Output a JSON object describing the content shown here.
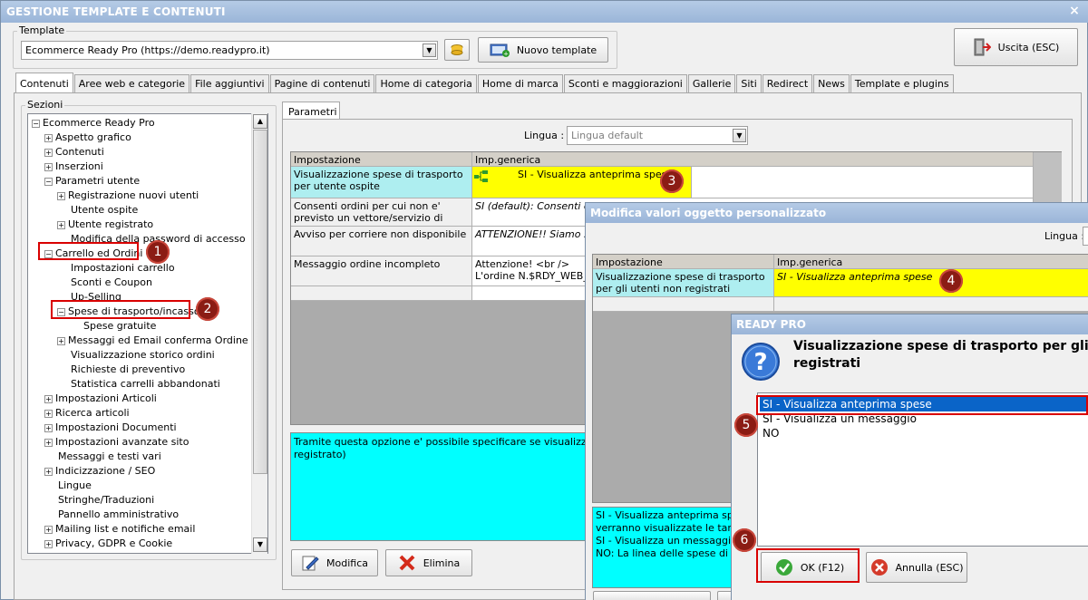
{
  "window": {
    "title": "GESTIONE TEMPLATE E CONTENUTI",
    "close": "×"
  },
  "template_group": {
    "label": "Template",
    "value": "Ecommerce Ready Pro (https://demo.readypro.it)"
  },
  "buttons": {
    "new_template": "Nuovo template",
    "exit": "Uscita (ESC)",
    "modify": "Modifica",
    "delete": "Elimina",
    "ok": "OK (F12)",
    "cancel": "Annulla (ESC)"
  },
  "tabs": [
    "Contenuti",
    "Aree web e categorie",
    "File aggiuntivi",
    "Pagine di contenuti",
    "Home di categoria",
    "Home di marca",
    "Sconti e maggiorazioni",
    "Gallerie",
    "Siti",
    "Redirect",
    "News",
    "Template e plugins"
  ],
  "sections": {
    "label": "Sezioni",
    "items": [
      {
        "text": "Ecommerce Ready Pro",
        "level": 0,
        "exp": "−"
      },
      {
        "text": "Aspetto grafico",
        "level": 1,
        "exp": "+"
      },
      {
        "text": "Contenuti",
        "level": 1,
        "exp": "+"
      },
      {
        "text": "Inserzioni",
        "level": 1,
        "exp": "+"
      },
      {
        "text": "Parametri utente",
        "level": 1,
        "exp": "−"
      },
      {
        "text": "Registrazione nuovi utenti",
        "level": 2,
        "exp": "+"
      },
      {
        "text": "Utente ospite",
        "level": 2,
        "exp": ""
      },
      {
        "text": "Utente registrato",
        "level": 2,
        "exp": "+"
      },
      {
        "text": "Modifica della password di accesso",
        "level": 2,
        "exp": ""
      },
      {
        "text": "Carrello ed Ordini",
        "level": 1,
        "exp": "−"
      },
      {
        "text": "Impostazioni carrello",
        "level": 2,
        "exp": ""
      },
      {
        "text": "Sconti e Coupon",
        "level": 2,
        "exp": ""
      },
      {
        "text": "Up-Selling",
        "level": 2,
        "exp": ""
      },
      {
        "text": "Spese di trasporto/incasso",
        "level": 2,
        "exp": "−"
      },
      {
        "text": "Spese gratuite",
        "level": 3,
        "exp": ""
      },
      {
        "text": "Messaggi ed Email conferma Ordine",
        "level": 2,
        "exp": "+"
      },
      {
        "text": "Visualizzazione storico ordini",
        "level": 2,
        "exp": ""
      },
      {
        "text": "Richieste di preventivo",
        "level": 2,
        "exp": ""
      },
      {
        "text": "Statistica carrelli abbandonati",
        "level": 2,
        "exp": ""
      },
      {
        "text": "Impostazioni Articoli",
        "level": 1,
        "exp": "+"
      },
      {
        "text": "Ricerca articoli",
        "level": 1,
        "exp": "+"
      },
      {
        "text": "Impostazioni Documenti",
        "level": 1,
        "exp": "+"
      },
      {
        "text": "Impostazioni avanzate sito",
        "level": 1,
        "exp": "+"
      },
      {
        "text": "Messaggi e testi vari",
        "level": 1,
        "exp": ""
      },
      {
        "text": "Indicizzazione / SEO",
        "level": 1,
        "exp": "+"
      },
      {
        "text": "Lingue",
        "level": 1,
        "exp": ""
      },
      {
        "text": "Stringhe/Traduzioni",
        "level": 1,
        "exp": ""
      },
      {
        "text": "Pannello amministrativo",
        "level": 1,
        "exp": ""
      },
      {
        "text": "Mailing list e notifiche email",
        "level": 1,
        "exp": "+"
      },
      {
        "text": "Privacy, GDPR e Cookie",
        "level": 1,
        "exp": "+"
      }
    ]
  },
  "params": {
    "tab": "Parametri",
    "language_label": "Lingua :",
    "language_value": "Lingua default",
    "col_setting": "Impostazione",
    "col_value": "Imp.generica",
    "rows": [
      {
        "setting": "Visualizzazione spese di trasporto per utente ospite",
        "value": "SI - Visualizza anteprima spese"
      },
      {
        "setting": "Consenti ordini per cui non e' previsto un vettore/servizio di consegna",
        "value": "SI (default): Consenti ordi"
      },
      {
        "setting": "Avviso per corriere non disponibile",
        "value": "ATTENZIONE!! Siamo spia"
      },
      {
        "setting": "Messaggio ordine incompleto",
        "value": "Attenzione! <br />",
        "value2": "L'ordine N.$RDY_WEB_OR"
      }
    ],
    "description": "Tramite questa opzione e' possibile specificare se visualizzare o men",
    "description2": "registrato)"
  },
  "dialog1": {
    "title": "Modifica valori oggetto personalizzato",
    "language_label": "Lingua :",
    "col_setting": "Impostazione",
    "col_value": "Imp.generica",
    "row_setting": "Visualizzazione spese di trasporto per gli utenti non registrati",
    "row_value": "SI - Visualizza anteprima spese",
    "notes": [
      "SI - Visualizza anteprima spese",
      "verranno visualizzate le tariffe",
      "SI - Visualizza un messaggio: Ve",
      "NO: La linea delle spese di trasp"
    ]
  },
  "dialog2": {
    "title": "READY PRO",
    "question": "Visualizzazione spese di trasporto per gli ut",
    "question2": "registrati",
    "options": [
      "SI - Visualizza anteprima spese",
      "SI - Visualizza un messaggio",
      "NO"
    ]
  },
  "badges": [
    "1",
    "2",
    "3",
    "4",
    "5",
    "6"
  ],
  "colors": {
    "titlebar": "#9ab5d8",
    "highlight_yellow": "#ffff00",
    "cyan": "#00ffff",
    "light_cyan": "#aeeef0",
    "badge": "#8b1c14",
    "selection": "#0a64c8"
  }
}
